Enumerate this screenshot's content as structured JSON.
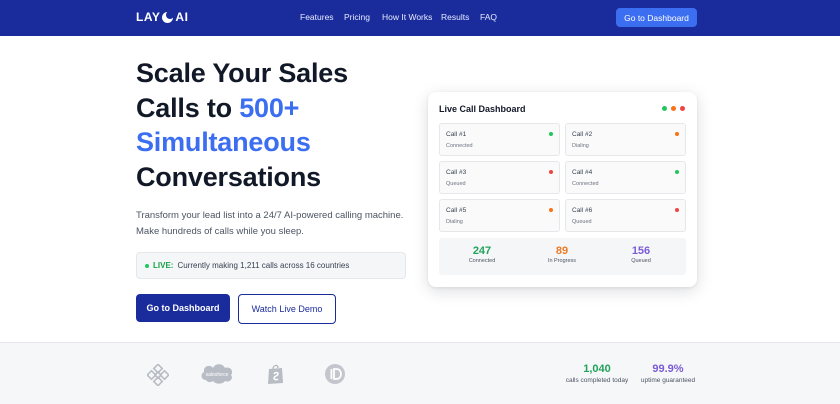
{
  "header": {
    "brand": "LAY",
    "brand_suffix": "AI",
    "nav": [
      "Features",
      "Pricing",
      "How It Works",
      "Results",
      "FAQ"
    ],
    "cta": "Go to Dashboard"
  },
  "hero": {
    "line1": "Scale Your Sales",
    "line2a": "Calls to ",
    "line2b": "500+",
    "line3": "Simultaneous",
    "line4": "Conversations",
    "sub": "Transform your lead list into a 24/7 AI-powered calling machine. Make hundreds of calls while you sleep.",
    "live_label": "LIVE:",
    "live_text": "Currently making 1,211 calls across 16 countries",
    "primary_btn": "Go to Dashboard",
    "secondary_btn": "Watch Live Demo"
  },
  "dashboard": {
    "title": "Live Call Dashboard",
    "calls": [
      {
        "name": "Call #1",
        "status": "Connected",
        "color": "#22c55e"
      },
      {
        "name": "Call #2",
        "status": "Dialing",
        "color": "#f97316"
      },
      {
        "name": "Call #3",
        "status": "Queued",
        "color": "#ef4444"
      },
      {
        "name": "Call #4",
        "status": "Connected",
        "color": "#22c55e"
      },
      {
        "name": "Call #5",
        "status": "Dialing",
        "color": "#f97316"
      },
      {
        "name": "Call #6",
        "status": "Queued",
        "color": "#ef4444"
      }
    ],
    "stats": [
      {
        "value": "247",
        "label": "Connected",
        "color": "#22a35a"
      },
      {
        "value": "89",
        "label": "In Progress",
        "color": "#ea7b26"
      },
      {
        "value": "156",
        "label": "Queued",
        "color": "#7c5cd6"
      }
    ]
  },
  "partners": {
    "salesforce": "salesforce"
  },
  "metrics": [
    {
      "value": "1,040",
      "label": "calls completed today",
      "color": "#22a35a"
    },
    {
      "value": "99.9%",
      "label": "uptime guaranteed",
      "color": "#7c5cd6"
    }
  ],
  "colors": {
    "brand_navy": "#1a2c9c",
    "accent_blue": "#3b6ef0"
  }
}
